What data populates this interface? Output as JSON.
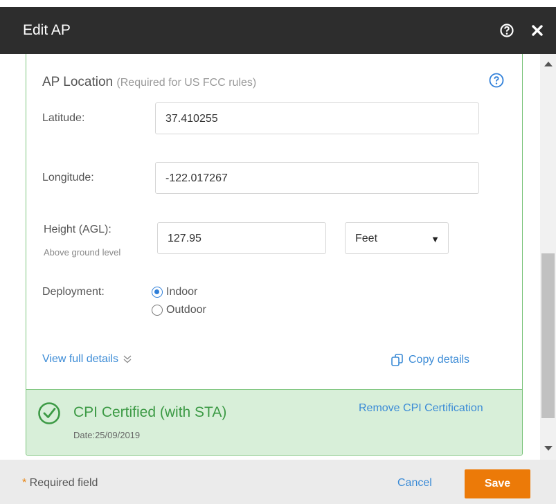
{
  "dialog": {
    "title": "Edit AP"
  },
  "location": {
    "title": "AP Location",
    "note": "(Required for US FCC rules)",
    "latitude_label": "Latitude:",
    "latitude_value": "37.410255",
    "longitude_label": "Longitude:",
    "longitude_value": "-122.017267",
    "height_label": "Height (AGL):",
    "height_sublabel": "Above ground level",
    "height_value": "127.95",
    "unit_selected": "Feet",
    "deployment_label": "Deployment:",
    "deployment_options": [
      "Indoor",
      "Outdoor"
    ],
    "deployment_selected": "Indoor"
  },
  "links": {
    "view_full_details": "View full details",
    "copy_details": "Copy details"
  },
  "certification": {
    "title": "CPI Certified (with STA)",
    "date": "Date:25/09/2019",
    "remove": "Remove CPI Certification"
  },
  "footer": {
    "required_star": "*",
    "required_text": " Required field",
    "cancel": "Cancel",
    "save": "Save"
  },
  "colors": {
    "header": "#2d2d2d",
    "accent_green": "#3c9a45",
    "link_blue": "#3b8bd6",
    "save_orange": "#ec7a08",
    "cert_bg": "#d8efd9"
  },
  "icons": [
    "help-circle-icon",
    "close-icon",
    "double-chevron-down-icon",
    "copy-icon",
    "check-circle-icon"
  ]
}
